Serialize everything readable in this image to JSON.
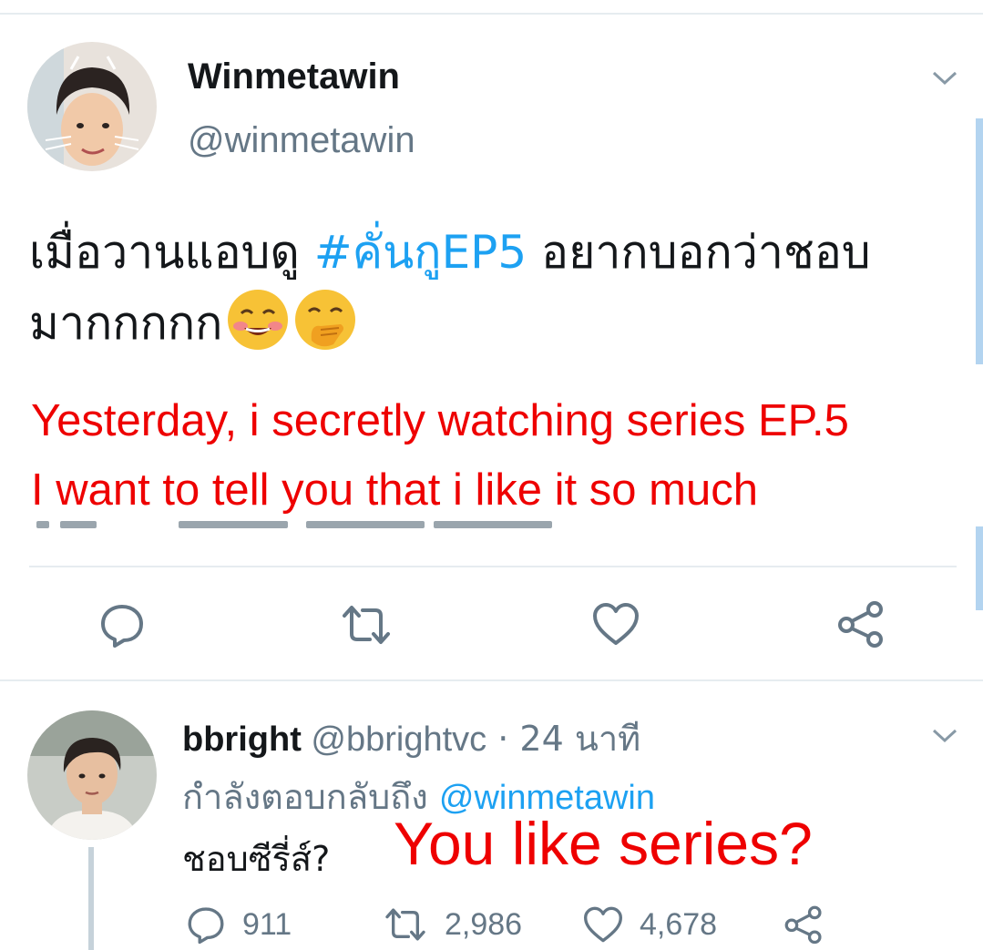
{
  "tweet": {
    "author_name": "Winmetawin",
    "author_handle": "@winmetawin",
    "text_before": "เมื่อวานแอบดู ",
    "hashtag": "#คั่นกูEP5",
    "text_after": " อยากบอกว่าชอบมากกกกก",
    "emojis": [
      "smiling-blush-emoji",
      "face-with-hand-over-mouth-emoji"
    ],
    "actions": [
      "reply-icon",
      "retweet-icon",
      "like-icon",
      "share-icon"
    ]
  },
  "overlay": {
    "translation_line1": "Yesterday, i secretly watching series EP.5",
    "translation_line2": "I want to tell you that i like it so much",
    "reply_translation": "You like series?"
  },
  "reply": {
    "author_name": "bbright",
    "author_handle": "@bbrightvc",
    "time": " · 24 นาที",
    "replying_to_label": "กำลังตอบกลับถึง ",
    "replying_to_handle": "@winmetawin",
    "text": "ชอบซีรี่ส์?",
    "reply_count": "911",
    "retweet_count": "2,986",
    "like_count": "4,678"
  },
  "colors": {
    "link": "#1da1f2",
    "muted": "#657786",
    "text": "#14171a",
    "translation": "#ee0000",
    "icon": "#657786"
  }
}
